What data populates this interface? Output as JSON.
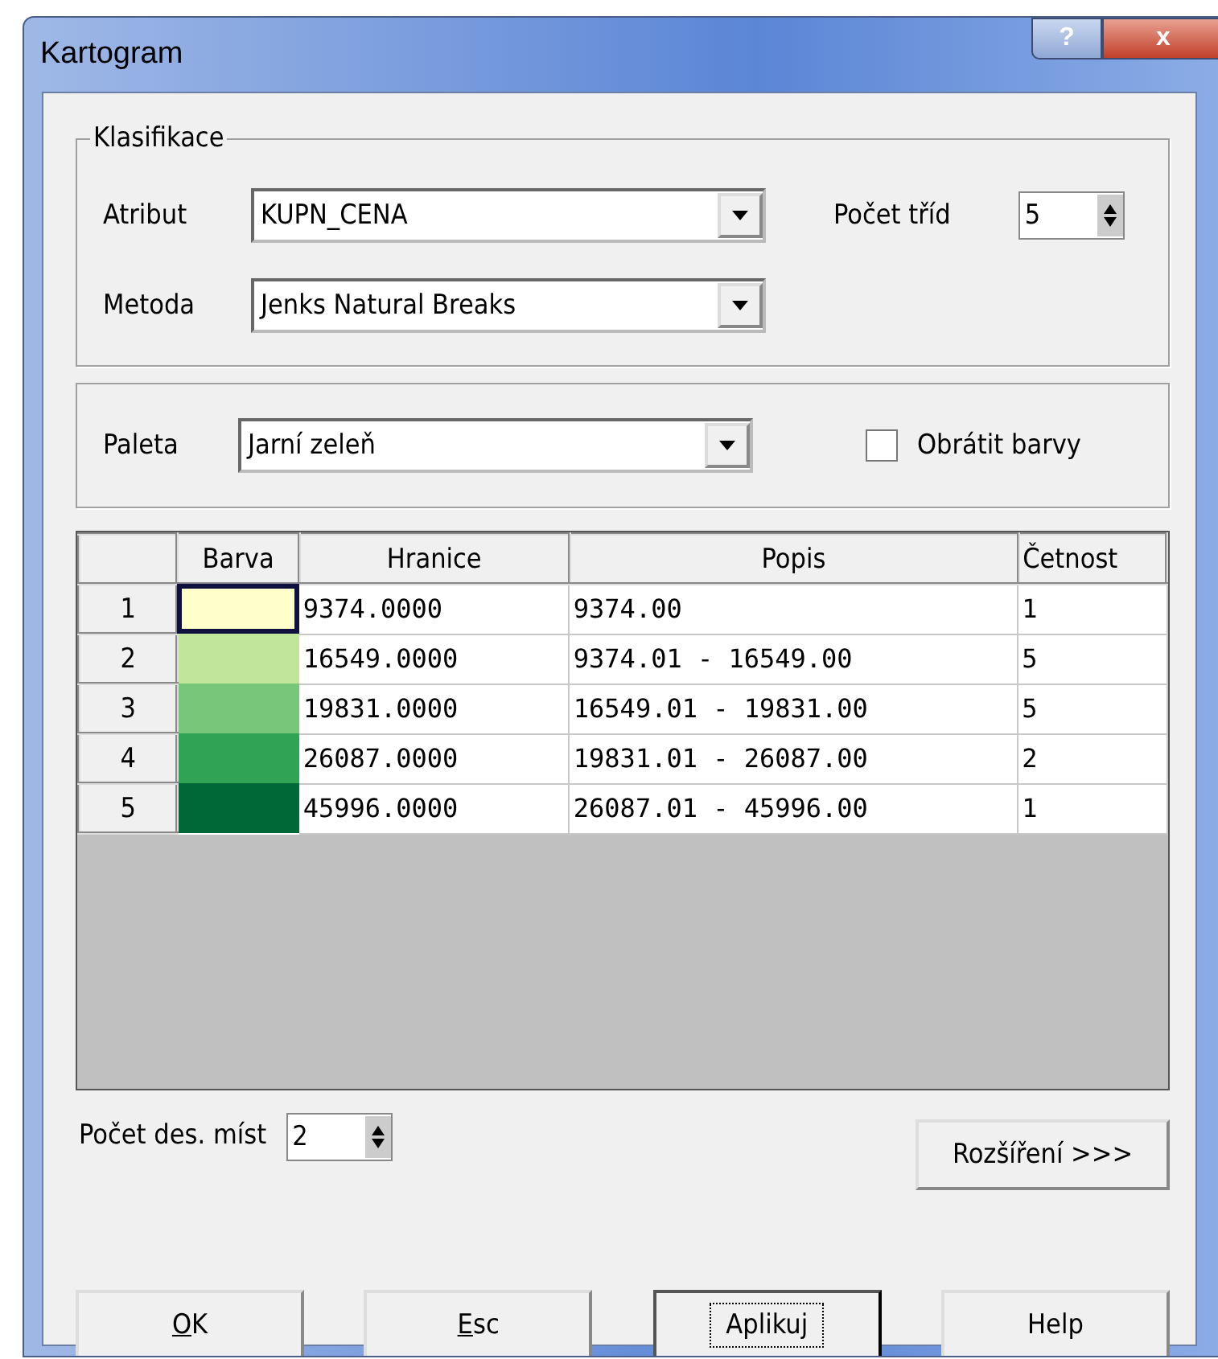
{
  "window": {
    "title": "Kartogram",
    "help_button": "?",
    "close_button": "x"
  },
  "classification": {
    "legend": "Klasifikace",
    "attribute_label": "Atribut",
    "attribute_value": "KUPN_CENA",
    "classes_label": "Počet tříd",
    "classes_value": "5",
    "method_label": "Metoda",
    "method_value": "Jenks Natural Breaks"
  },
  "palette": {
    "label": "Paleta",
    "value": "Jarní zeleň",
    "reverse_label": "Obrátit barvy",
    "reverse_checked": false
  },
  "table": {
    "columns": [
      "Barva",
      "Hranice",
      "Popis",
      "Četnost"
    ],
    "rows": [
      {
        "index": "1",
        "color": "#ffffcc",
        "selected": true,
        "limit": "9374.0000",
        "description": "9374.00",
        "count": "1"
      },
      {
        "index": "2",
        "color": "#c2e699",
        "selected": false,
        "limit": "16549.0000",
        "description": "9374.01 - 16549.00",
        "count": "5"
      },
      {
        "index": "3",
        "color": "#78c679",
        "selected": false,
        "limit": "19831.0000",
        "description": "16549.01 - 19831.00",
        "count": "5"
      },
      {
        "index": "4",
        "color": "#31a354",
        "selected": false,
        "limit": "26087.0000",
        "description": "19831.01 - 26087.00",
        "count": "2"
      },
      {
        "index": "5",
        "color": "#006837",
        "selected": false,
        "limit": "45996.0000",
        "description": "26087.01 - 45996.00",
        "count": "1"
      }
    ]
  },
  "decimals": {
    "label": "Počet des. míst",
    "value": "2"
  },
  "extend_button": "Rozšíření >>>",
  "buttons": [
    {
      "label": "OK",
      "mnemonic": true,
      "focused": false
    },
    {
      "label": "Esc",
      "mnemonic": true,
      "focused": false
    },
    {
      "label": "Aplikuj",
      "mnemonic": false,
      "focused": true
    },
    {
      "label": "Help",
      "mnemonic": false,
      "focused": false
    }
  ]
}
